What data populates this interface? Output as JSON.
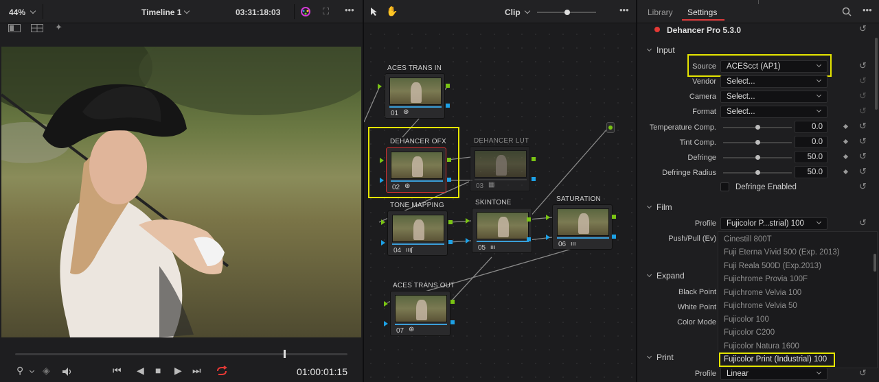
{
  "viewer": {
    "zoom": "44%",
    "timeline": "Timeline 1",
    "source_timecode": "03:31:18:03",
    "record_timecode": "01:00:01:15",
    "playhead_fraction": 0.81
  },
  "node_editor": {
    "mode": "Clip",
    "nodes": [
      {
        "label": "ACES TRANS IN",
        "num": "01"
      },
      {
        "label": "DEHANCER OFX",
        "num": "02"
      },
      {
        "label": "DEHANCER LUT",
        "num": "03"
      },
      {
        "label": "TONE MAPPING",
        "num": "04"
      },
      {
        "label": "SKINTONE",
        "num": "05"
      },
      {
        "label": "SATURATION",
        "num": "06"
      },
      {
        "label": "ACES TRANS OUT",
        "num": "07"
      }
    ]
  },
  "settings": {
    "tabs": {
      "library": "Library",
      "settings": "Settings"
    },
    "plugin": "Dehancer Pro 5.3.0",
    "input": {
      "section": "Input",
      "source_label": "Source",
      "source_value": "ACEScct (AP1)",
      "vendor_label": "Vendor",
      "vendor_value": "Select...",
      "camera_label": "Camera",
      "camera_value": "Select...",
      "format_label": "Format",
      "format_value": "Select...",
      "temp_label": "Temperature Comp.",
      "temp_value": "0.0",
      "tint_label": "Tint Comp.",
      "tint_value": "0.0",
      "defringe_label": "Defringe",
      "defringe_value": "50.0",
      "defringe_radius_label": "Defringe Radius",
      "defringe_radius_value": "50.0",
      "defringe_enabled_label": "Defringe Enabled"
    },
    "film": {
      "section": "Film",
      "profile_label": "Profile",
      "profile_value": "Fujicolor P...strial) 100",
      "pushpull_label": "Push/Pull (Ev)"
    },
    "expand": {
      "section": "Expand",
      "black_point_label": "Black Point",
      "white_point_label": "White Point",
      "color_mode_label": "Color Mode"
    },
    "print": {
      "section": "Print",
      "profile_label": "Profile",
      "profile_value": "Linear"
    },
    "profile_options": [
      "Cinestill 800T",
      "Fuji Eterna Vivid 500 (Exp. 2013)",
      "Fuji Reala 500D (Exp.2013)",
      "Fujichrome Provia 100F",
      "Fujichrome Velvia 100",
      "Fujichrome Velvia 50",
      "Fujicolor 100",
      "Fujicolor C200",
      "Fujicolor Natura 1600",
      "Fujicolor Print (Industrial) 100"
    ]
  },
  "colors": {
    "accent_red": "#e03b3b",
    "highlight_yellow": "#e6e600",
    "port_green": "#7ac414",
    "port_blue": "#1da1e6"
  }
}
